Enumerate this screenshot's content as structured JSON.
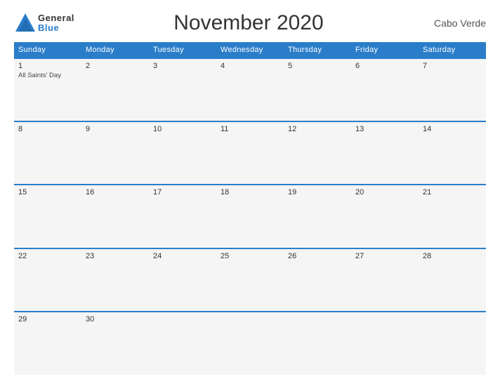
{
  "header": {
    "logo_general": "General",
    "logo_blue": "Blue",
    "title": "November 2020",
    "country": "Cabo Verde"
  },
  "days_of_week": [
    "Sunday",
    "Monday",
    "Tuesday",
    "Wednesday",
    "Thursday",
    "Friday",
    "Saturday"
  ],
  "weeks": [
    [
      {
        "day": "1",
        "event": "All Saints' Day"
      },
      {
        "day": "2",
        "event": ""
      },
      {
        "day": "3",
        "event": ""
      },
      {
        "day": "4",
        "event": ""
      },
      {
        "day": "5",
        "event": ""
      },
      {
        "day": "6",
        "event": ""
      },
      {
        "day": "7",
        "event": ""
      }
    ],
    [
      {
        "day": "8",
        "event": ""
      },
      {
        "day": "9",
        "event": ""
      },
      {
        "day": "10",
        "event": ""
      },
      {
        "day": "11",
        "event": ""
      },
      {
        "day": "12",
        "event": ""
      },
      {
        "day": "13",
        "event": ""
      },
      {
        "day": "14",
        "event": ""
      }
    ],
    [
      {
        "day": "15",
        "event": ""
      },
      {
        "day": "16",
        "event": ""
      },
      {
        "day": "17",
        "event": ""
      },
      {
        "day": "18",
        "event": ""
      },
      {
        "day": "19",
        "event": ""
      },
      {
        "day": "20",
        "event": ""
      },
      {
        "day": "21",
        "event": ""
      }
    ],
    [
      {
        "day": "22",
        "event": ""
      },
      {
        "day": "23",
        "event": ""
      },
      {
        "day": "24",
        "event": ""
      },
      {
        "day": "25",
        "event": ""
      },
      {
        "day": "26",
        "event": ""
      },
      {
        "day": "27",
        "event": ""
      },
      {
        "day": "28",
        "event": ""
      }
    ],
    [
      {
        "day": "29",
        "event": ""
      },
      {
        "day": "30",
        "event": ""
      },
      {
        "day": "",
        "event": ""
      },
      {
        "day": "",
        "event": ""
      },
      {
        "day": "",
        "event": ""
      },
      {
        "day": "",
        "event": ""
      },
      {
        "day": "",
        "event": ""
      }
    ]
  ]
}
